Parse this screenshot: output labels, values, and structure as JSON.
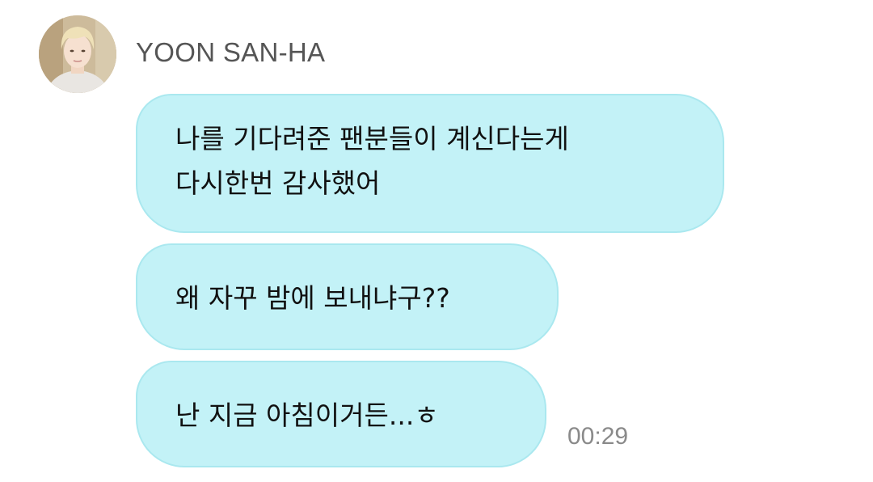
{
  "chat": {
    "sender_name": "YOON SAN-HA",
    "avatar_icon": "profile-photo-avatar",
    "bubble_color": "#c3f2f7",
    "messages": [
      {
        "lines": [
          "나를 기다려준 팬분들이 계신다는게",
          "다시한번 감사했어"
        ]
      },
      {
        "lines": [
          "왜 자꾸 밤에 보내냐구??"
        ]
      },
      {
        "lines": [
          "난 지금 아침이거든...ㅎ"
        ]
      }
    ],
    "timestamp": "00:29"
  }
}
